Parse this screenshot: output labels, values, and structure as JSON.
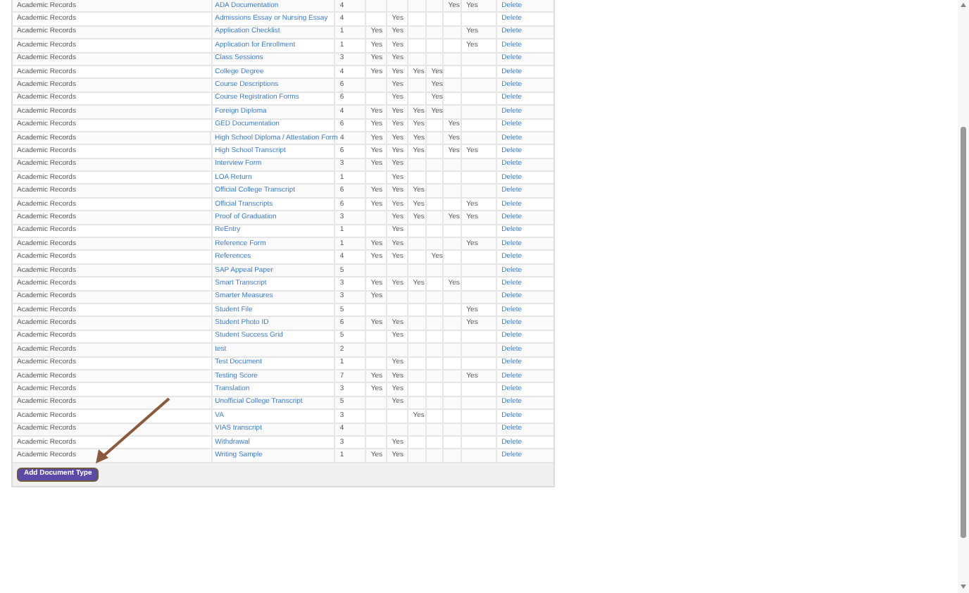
{
  "table": {
    "rows": [
      {
        "category": "Academic Records",
        "name": "ADA Documentation",
        "column_3": "4",
        "column_8": "Yes",
        "column_9": "Yes",
        "action": "Delete"
      },
      {
        "category": "Academic Records",
        "name": "Admissions Essay or Nursing Essay",
        "column_3": "4",
        "column_5": "Yes",
        "action": "Delete"
      },
      {
        "category": "Academic Records",
        "name": "Application Checklist",
        "column_3": "1",
        "column_4": "Yes",
        "column_5": "Yes",
        "column_9": "Yes",
        "action": "Delete"
      },
      {
        "category": "Academic Records",
        "name": "Application for Enrollment",
        "column_3": "1",
        "column_4": "Yes",
        "column_5": "Yes",
        "column_9": "Yes",
        "action": "Delete"
      },
      {
        "category": "Academic Records",
        "name": "Class Sessions",
        "column_3": "3",
        "column_4": "Yes",
        "column_5": "Yes",
        "action": "Delete"
      },
      {
        "category": "Academic Records",
        "name": "College Degree",
        "column_3": "4",
        "column_4": "Yes",
        "column_5": "Yes",
        "column_6": "Yes",
        "column_7": "Yes",
        "action": "Delete"
      },
      {
        "category": "Academic Records",
        "name": "Course Descriptions",
        "column_3": "6",
        "column_5": "Yes",
        "column_7": "Yes",
        "action": "Delete"
      },
      {
        "category": "Academic Records",
        "name": "Course Registration Forms",
        "column_3": "6",
        "column_5": "Yes",
        "column_7": "Yes",
        "action": "Delete"
      },
      {
        "category": "Academic Records",
        "name": "Foreign Diploma",
        "column_3": "4",
        "column_4": "Yes",
        "column_5": "Yes",
        "column_6": "Yes",
        "column_7": "Yes",
        "action": "Delete"
      },
      {
        "category": "Academic Records",
        "name": "GED Documentation",
        "column_3": "6",
        "column_4": "Yes",
        "column_5": "Yes",
        "column_6": "Yes",
        "column_8": "Yes",
        "action": "Delete"
      },
      {
        "category": "Academic Records",
        "name": "High School Diploma / Attestation Form",
        "column_3": "4",
        "column_4": "Yes",
        "column_5": "Yes",
        "column_6": "Yes",
        "column_8": "Yes",
        "action": "Delete"
      },
      {
        "category": "Academic Records",
        "name": "High School Transcript",
        "column_3": "6",
        "column_4": "Yes",
        "column_5": "Yes",
        "column_6": "Yes",
        "column_8": "Yes",
        "column_9": "Yes",
        "action": "Delete"
      },
      {
        "category": "Academic Records",
        "name": "Interview Form",
        "column_3": "3",
        "column_4": "Yes",
        "column_5": "Yes",
        "action": "Delete"
      },
      {
        "category": "Academic Records",
        "name": "LOA Return",
        "column_3": "1",
        "column_5": "Yes",
        "action": "Delete"
      },
      {
        "category": "Academic Records",
        "name": "Official College Transcript",
        "column_3": "6",
        "column_4": "Yes",
        "column_5": "Yes",
        "column_6": "Yes",
        "action": "Delete"
      },
      {
        "category": "Academic Records",
        "name": "Official Transcripts",
        "column_3": "6",
        "column_4": "Yes",
        "column_5": "Yes",
        "column_6": "Yes",
        "column_9": "Yes",
        "action": "Delete"
      },
      {
        "category": "Academic Records",
        "name": "Proof of Graduation",
        "column_3": "3",
        "column_5": "Yes",
        "column_6": "Yes",
        "column_8": "Yes",
        "column_9": "Yes",
        "action": "Delete"
      },
      {
        "category": "Academic Records",
        "name": "ReEntry",
        "column_3": "1",
        "column_5": "Yes",
        "action": "Delete"
      },
      {
        "category": "Academic Records",
        "name": "Reference Form",
        "column_3": "1",
        "column_4": "Yes",
        "column_5": "Yes",
        "column_9": "Yes",
        "action": "Delete"
      },
      {
        "category": "Academic Records",
        "name": "References",
        "column_3": "4",
        "column_4": "Yes",
        "column_5": "Yes",
        "column_7": "Yes",
        "action": "Delete"
      },
      {
        "category": "Academic Records",
        "name": "SAP Appeal Paper",
        "column_3": "5",
        "action": "Delete"
      },
      {
        "category": "Academic Records",
        "name": "Smart Transcript",
        "column_3": "3",
        "column_4": "Yes",
        "column_5": "Yes",
        "column_6": "Yes",
        "column_8": "Yes",
        "action": "Delete"
      },
      {
        "category": "Academic Records",
        "name": "Smarter Measures",
        "column_3": "3",
        "column_4": "Yes",
        "action": "Delete"
      },
      {
        "category": "Academic Records",
        "name": "Student File",
        "column_3": "5",
        "column_9": "Yes",
        "action": "Delete"
      },
      {
        "category": "Academic Records",
        "name": "Student Photo ID",
        "column_3": "6",
        "column_4": "Yes",
        "column_5": "Yes",
        "column_9": "Yes",
        "action": "Delete"
      },
      {
        "category": "Academic Records",
        "name": "Student Success Grid",
        "column_3": "5",
        "column_5": "Yes",
        "action": "Delete"
      },
      {
        "category": "Academic Records",
        "name": "test",
        "column_3": "2",
        "action": "Delete"
      },
      {
        "category": "Academic Records",
        "name": "Test Document",
        "column_3": "1",
        "column_5": "Yes",
        "action": "Delete"
      },
      {
        "category": "Academic Records",
        "name": "Testing Score",
        "column_3": "7",
        "column_4": "Yes",
        "column_5": "Yes",
        "column_9": "Yes",
        "action": "Delete"
      },
      {
        "category": "Academic Records",
        "name": "Translation",
        "column_3": "3",
        "column_4": "Yes",
        "column_5": "Yes",
        "action": "Delete"
      },
      {
        "category": "Academic Records",
        "name": "Unofficial College Transcript",
        "column_3": "5",
        "column_5": "Yes",
        "action": "Delete"
      },
      {
        "category": "Academic Records",
        "name": "VA",
        "column_3": "3",
        "column_6": "Yes",
        "action": "Delete"
      },
      {
        "category": "Academic Records",
        "name": "VIAS transcript",
        "column_3": "4",
        "action": "Delete"
      },
      {
        "category": "Academic Records",
        "name": "Withdrawal",
        "column_3": "3",
        "column_5": "Yes",
        "action": "Delete"
      },
      {
        "category": "Academic Records",
        "name": "Writing Sample",
        "column_3": "1",
        "column_4": "Yes",
        "column_5": "Yes",
        "action": "Delete"
      }
    ]
  },
  "footer": {
    "button": "Add Document Type"
  }
}
